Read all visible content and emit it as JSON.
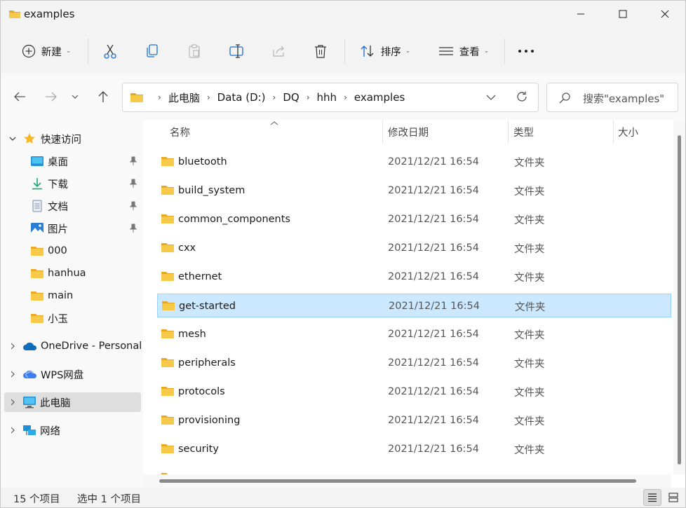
{
  "window": {
    "title": "examples"
  },
  "toolbar": {
    "new_label": "新建",
    "sort_label": "排序",
    "view_label": "查看"
  },
  "address": {
    "crumbs": [
      "此电脑",
      "Data (D:)",
      "DQ",
      "hhh",
      "examples"
    ]
  },
  "search": {
    "placeholder": "搜索\"examples\""
  },
  "sidebar": {
    "quick_access": "快速访问",
    "items": [
      {
        "label": "桌面",
        "icon": "desktop-icon",
        "pinned": true
      },
      {
        "label": "下载",
        "icon": "download-icon",
        "pinned": true
      },
      {
        "label": "文档",
        "icon": "document-icon",
        "pinned": true
      },
      {
        "label": "图片",
        "icon": "picture-icon",
        "pinned": true
      },
      {
        "label": "000",
        "icon": "folder-icon",
        "pinned": false
      },
      {
        "label": "hanhua",
        "icon": "folder-icon",
        "pinned": false
      },
      {
        "label": "main",
        "icon": "folder-icon",
        "pinned": false
      },
      {
        "label": "小玉",
        "icon": "folder-icon",
        "pinned": false
      }
    ],
    "onedrive": "OneDrive - Personal",
    "wps": "WPS网盘",
    "this_pc": "此电脑",
    "network": "网络"
  },
  "list": {
    "columns": {
      "name": "名称",
      "date": "修改日期",
      "type": "类型",
      "size": "大小"
    },
    "rows": [
      {
        "name": "bluetooth",
        "date": "2021/12/21 16:54",
        "type": "文件夹"
      },
      {
        "name": "build_system",
        "date": "2021/12/21 16:54",
        "type": "文件夹"
      },
      {
        "name": "common_components",
        "date": "2021/12/21 16:54",
        "type": "文件夹"
      },
      {
        "name": "cxx",
        "date": "2021/12/21 16:54",
        "type": "文件夹"
      },
      {
        "name": "ethernet",
        "date": "2021/12/21 16:54",
        "type": "文件夹"
      },
      {
        "name": "get-started",
        "date": "2021/12/21 16:54",
        "type": "文件夹"
      },
      {
        "name": "mesh",
        "date": "2021/12/21 16:54",
        "type": "文件夹"
      },
      {
        "name": "peripherals",
        "date": "2021/12/21 16:54",
        "type": "文件夹"
      },
      {
        "name": "protocols",
        "date": "2021/12/21 16:54",
        "type": "文件夹"
      },
      {
        "name": "provisioning",
        "date": "2021/12/21 16:54",
        "type": "文件夹"
      },
      {
        "name": "security",
        "date": "2021/12/21 16:54",
        "type": "文件夹"
      }
    ],
    "selected_index": 5
  },
  "status": {
    "count": "15 个项目",
    "selection": "选中 1 个项目"
  },
  "colors": {
    "folder": "#f4c542",
    "selection": "#cce8ff",
    "accent": "#0078d4"
  }
}
